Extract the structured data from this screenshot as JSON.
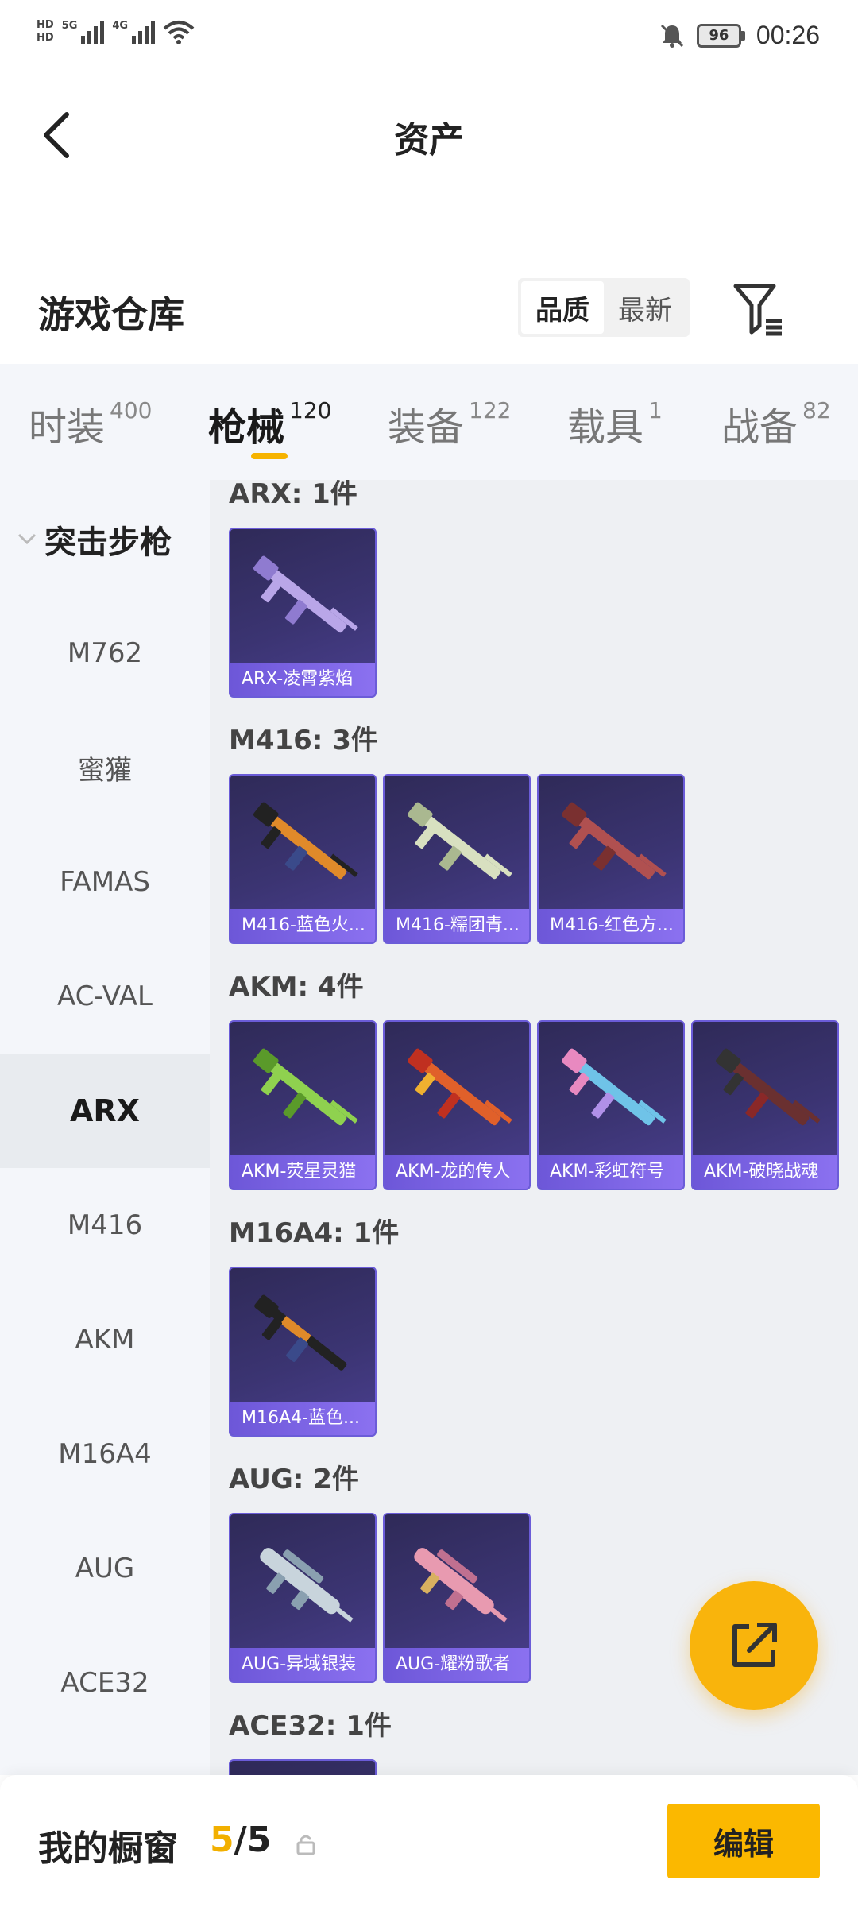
{
  "status_bar": {
    "hd_top": "HD",
    "hd_bottom": "HD",
    "net1": "5G",
    "net2": "4G",
    "battery": "96",
    "time": "00:26",
    "icons": [
      "signal-icon",
      "wifi-icon",
      "mute-bell-icon",
      "battery-icon"
    ]
  },
  "header": {
    "title": "资产",
    "back_icon": "chevron-left-icon"
  },
  "warehouse": {
    "title": "游戏仓库",
    "sort_options": [
      "品质",
      "最新"
    ],
    "sort_active": "品质",
    "filter_icon": "filter-icon"
  },
  "tabs": [
    {
      "label": "时装",
      "count": "400"
    },
    {
      "label": "枪械",
      "count": "120",
      "active": true
    },
    {
      "label": "装备",
      "count": "122"
    },
    {
      "label": "载具",
      "count": "1"
    },
    {
      "label": "战备",
      "count": "82"
    }
  ],
  "sidebar": {
    "group": "突击步枪",
    "items": [
      "M762",
      "蜜獾",
      "FAMAS",
      "AC-VAL",
      "ARX",
      "M416",
      "AKM",
      "M16A4",
      "AUG",
      "ACE32"
    ],
    "active": "ARX"
  },
  "sections": [
    {
      "title": "ARX: 1件",
      "items": [
        "ARX-凌霄紫焰"
      ]
    },
    {
      "title": "M416: 3件",
      "items": [
        "M416-蓝色火...",
        "M416-糯团青...",
        "M416-红色方..."
      ]
    },
    {
      "title": "AKM: 4件",
      "items": [
        "AKM-荧星灵猫",
        "AKM-龙的传人",
        "AKM-彩虹符号",
        "AKM-破晓战魂"
      ]
    },
    {
      "title": "M16A4: 1件",
      "items": [
        "M16A4-蓝色..."
      ]
    },
    {
      "title": "AUG: 2件",
      "items": [
        "AUG-异域银装",
        "AUG-耀粉歌者"
      ]
    },
    {
      "title": "ACE32: 1件",
      "items": [
        ""
      ]
    }
  ],
  "gun_colors": {
    "purple": "#b9a6e8",
    "orange": "#e08a2a",
    "cream": "#d8e0c0",
    "red": "#b05050",
    "green": "#8fd14f",
    "dragon": "#e0602a",
    "rainbow": "#6fc3e8",
    "dark": "#6a3030",
    "navy": "#3a4a8a",
    "silver": "#c8d4dc",
    "pink": "#e89ab0"
  },
  "fab_icon": "share-export-icon",
  "bottom_bar": {
    "label": "我的橱窗",
    "current": "5",
    "separator": "/",
    "total": "5",
    "lock_icon": "lock-icon",
    "edit_label": "编辑"
  }
}
